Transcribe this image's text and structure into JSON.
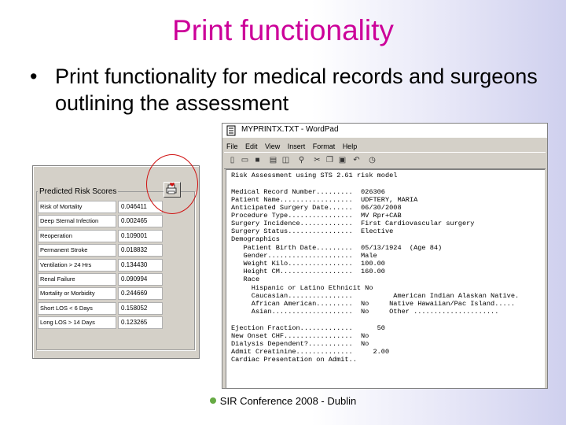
{
  "slide": {
    "title": "Print functionality",
    "bullet_symbol": "•",
    "bullet_text": "Print functionality for medical records and surgeons outlining the assessment",
    "footer": "SIR Conference 2008 - Dublin"
  },
  "risk_panel": {
    "title": "Predicted Risk Scores",
    "rows": [
      {
        "label": "Risk of Mortality",
        "value": "0.046411"
      },
      {
        "label": "Deep Sternal Infection",
        "value": "0.002465"
      },
      {
        "label": "Reoperation",
        "value": "0.109001"
      },
      {
        "label": "Permanent Stroke",
        "value": "0.018832"
      },
      {
        "label": "Ventilation > 24 Hrs",
        "value": "0.134430"
      },
      {
        "label": "Renal Failure",
        "value": "0.090994"
      },
      {
        "label": "Mortality or Morbidity",
        "value": "0.244669"
      },
      {
        "label": "Short LOS < 6 Days",
        "value": "0.158052"
      },
      {
        "label": "Long LOS > 14 Days",
        "value": "0.123265"
      }
    ]
  },
  "wordpad": {
    "title": "MYPRINTX.TXT - WordPad",
    "menu": [
      "File",
      "Edit",
      "View",
      "Insert",
      "Format",
      "Help"
    ],
    "doc_lines": [
      "Risk Assessment using STS 2.61 risk model",
      "",
      "Medical Record Number.........  026306",
      "Patient Name..................  UDFTERY, MARIA",
      "Anticipated Surgery Date......  06/30/2008",
      "Procedure Type................  MV Rpr+CAB",
      "Surgery Incidence.............  First Cardiovascular surgery",
      "Surgery Status................  Elective",
      "Demographics",
      "   Patient Birth Date.........  05/13/1924  (Age 84)",
      "   Gender.....................  Male",
      "   Weight Kilo................  100.00",
      "   Height CM..................  160.00",
      "   Race",
      "     Hispanic or Latino Ethnicit No",
      "     Caucasian................          American Indian Alaskan Native.",
      "     African American.........  No     Native Hawaiian/Pac Island.....",
      "     Asian....................  No     Other .....................",
      "",
      "Ejection Fraction.............      50",
      "New Onset CHF.................  No",
      "Dialysis Dependent?...........  No",
      "Admit Creatinine..............     2.00",
      "Cardiac Presentation on Admit.."
    ]
  }
}
